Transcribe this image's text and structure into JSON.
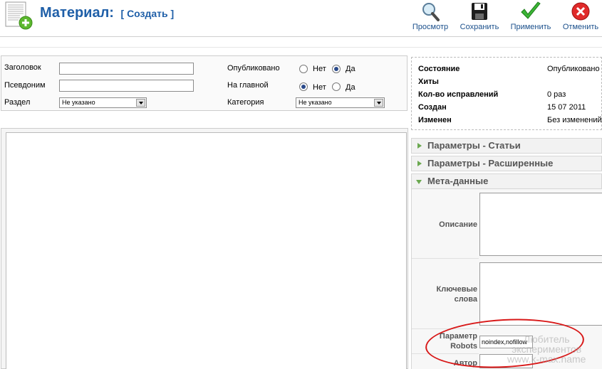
{
  "header": {
    "title": "Материал:",
    "subtitle": "[ Создать ]"
  },
  "toolbar": {
    "preview_label": "Просмотр",
    "save_label": "Сохранить",
    "apply_label": "Применить",
    "cancel_label": "Отменить",
    "preview_icon": "magnifier-icon",
    "save_icon": "floppy-disk-icon",
    "apply_icon": "checkmark-icon",
    "cancel_icon": "cancel-icon"
  },
  "details": {
    "title_label": "Заголовок",
    "title_value": "",
    "alias_label": "Псевдоним",
    "alias_value": "",
    "section_label": "Раздел",
    "section_value": "Не указано",
    "published_label": "Опубликовано",
    "frontpage_label": "На главной",
    "category_label": "Категория",
    "category_value": "Не указано",
    "no_label": "Нет",
    "yes_label": "Да",
    "published_selected": "Да",
    "frontpage_selected": "Нет"
  },
  "status": {
    "rows": [
      {
        "label": "Состояние",
        "value": "Опубликовано"
      },
      {
        "label": "Хиты",
        "value": ""
      },
      {
        "label": "Кол-во исправлений",
        "value": "0 раз"
      },
      {
        "label": "Создан",
        "value": "15 07 2011"
      },
      {
        "label": "Изменен",
        "value": "Без изменений"
      }
    ]
  },
  "accordion": {
    "article_params": "Параметры - Статьи",
    "advanced_params": "Параметры - Расширенные",
    "metadata": "Мета-данные"
  },
  "metadata": {
    "description_label": "Описание",
    "keywords_label_line1": "Ключевые",
    "keywords_label_line2": "слова",
    "robots_label_line1": "Параметр",
    "robots_label_line2": "Robots",
    "robots_value": "noindex,nofillow",
    "author_label": "Автор"
  },
  "watermark": {
    "line1": "Любитель",
    "line2": "экспериментов",
    "line3": "www.k-max.name"
  },
  "colors": {
    "title_blue": "#1f5fa8",
    "accordion_green": "#6aa84f",
    "annotation_red": "#d81818"
  }
}
